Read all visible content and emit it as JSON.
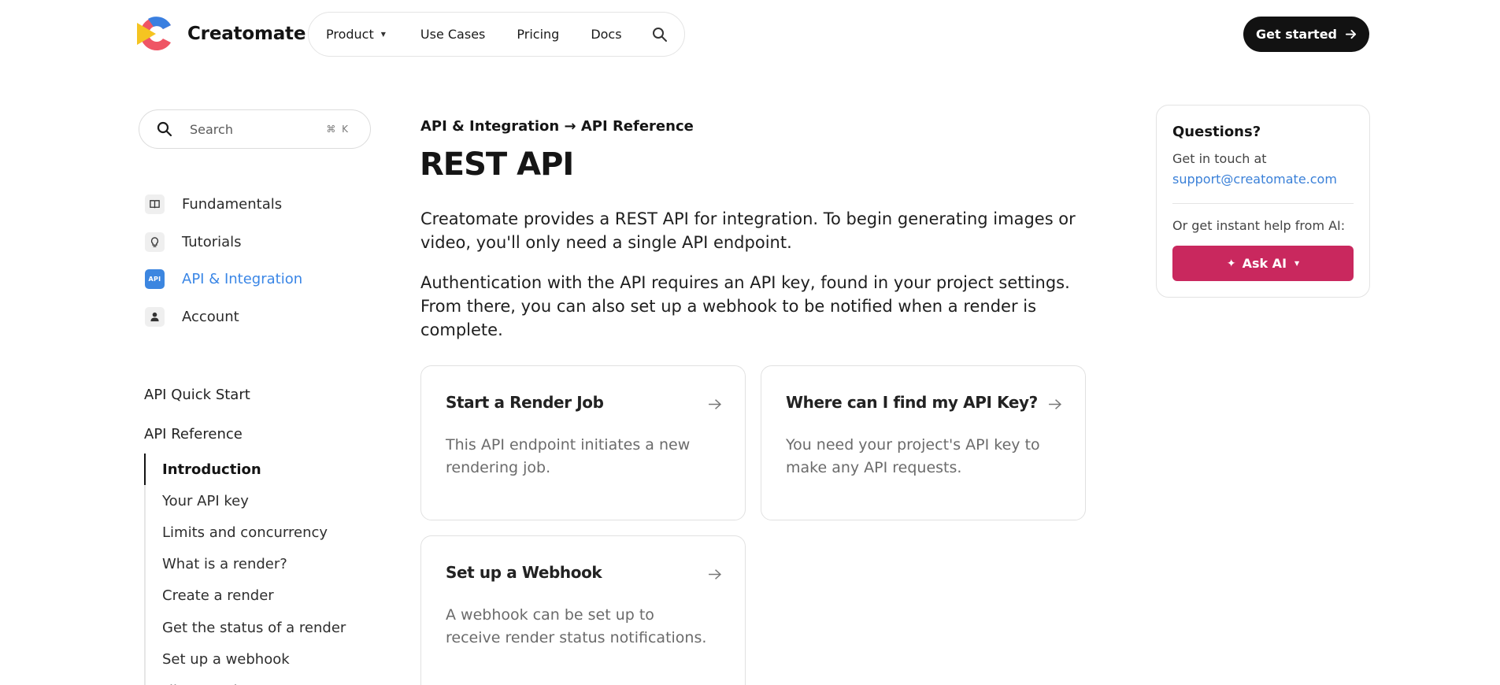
{
  "brand": {
    "name": "Creatomate"
  },
  "topnav": {
    "items": [
      {
        "label": "Product",
        "has_dropdown": true
      },
      {
        "label": "Use Cases"
      },
      {
        "label": "Pricing"
      },
      {
        "label": "Docs"
      }
    ],
    "search_icon": "search-icon"
  },
  "cta": {
    "label": "Get started",
    "icon": "arrow-right-icon"
  },
  "sidebar": {
    "search": {
      "placeholder": "Search",
      "shortcut": "⌘ K"
    },
    "categories": [
      {
        "label": "Fundamentals",
        "icon": "book-icon"
      },
      {
        "label": "Tutorials",
        "icon": "lightbulb-icon"
      },
      {
        "label": "API & Integration",
        "icon": "api-icon",
        "icon_text": "API",
        "active": true
      },
      {
        "label": "Account",
        "icon": "user-icon"
      }
    ],
    "quick_start": "API Quick Start",
    "reference": "API Reference",
    "sub_items": [
      "Introduction",
      "Your API key",
      "Limits and concurrency",
      "What is a render?",
      "Create a render",
      "Get the status of a render",
      "Set up a webhook",
      "File retention"
    ]
  },
  "main": {
    "breadcrumb": "API & Integration → API Reference",
    "title": "REST API",
    "paragraphs": [
      "Creatomate provides a REST API for integration. To begin generating images or video, you'll only need a single API endpoint.",
      "Authentication with the API requires an API key, found in your project settings. From there, you can also set up a webhook to be notified when a render is complete."
    ],
    "cards": [
      {
        "title": "Start a Render Job",
        "description": "This API endpoint initiates a new rendering job."
      },
      {
        "title": "Where can I find my API Key?",
        "description": "You need your project's API key to make any API requests."
      },
      {
        "title": "Set up a Webhook",
        "description": "A webhook can be set up to receive render status notifications."
      }
    ]
  },
  "help": {
    "title": "Questions?",
    "touch": "Get in touch at",
    "email": "support@creatomate.com",
    "instant": "Or get instant help from AI:",
    "ask_label": "Ask AI",
    "accent": "#c9285e"
  },
  "colors": {
    "link": "#3a86e6",
    "dark": "#121212",
    "api_badge": "#3c86e0"
  }
}
